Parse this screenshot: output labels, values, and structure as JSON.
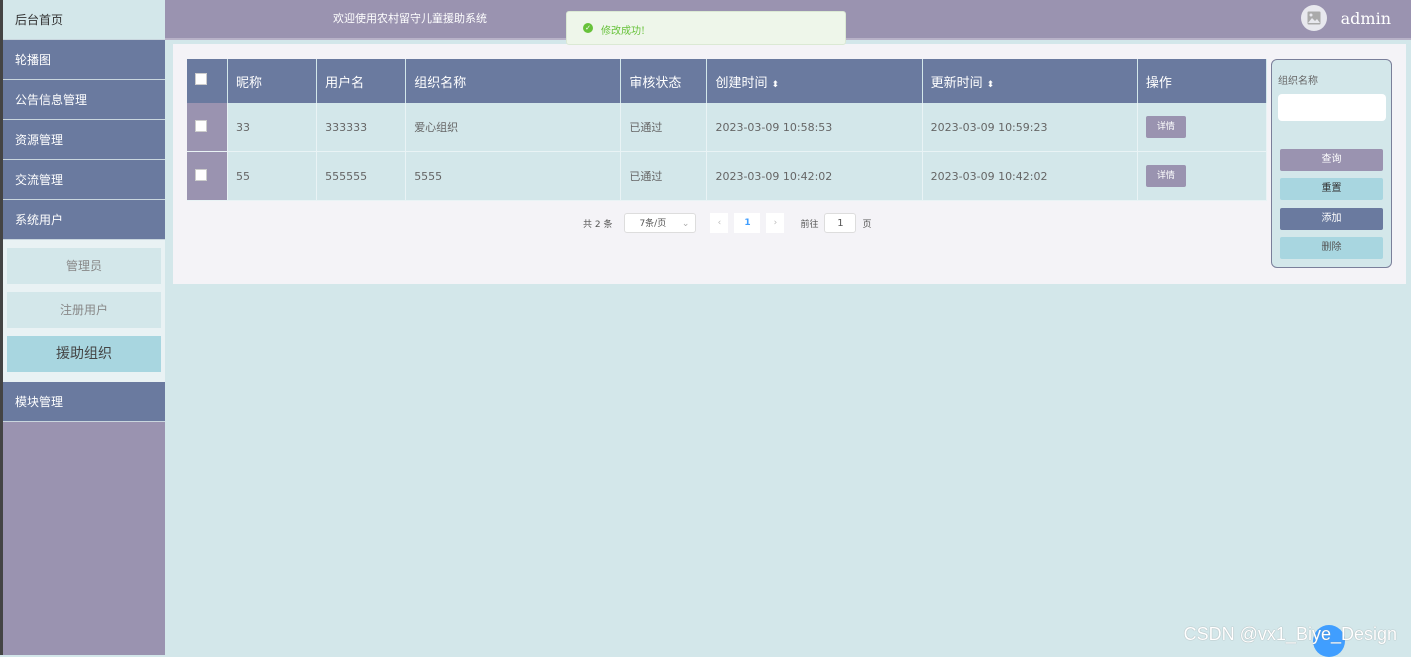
{
  "sidebar": {
    "items": [
      {
        "label": "后台首页"
      },
      {
        "label": "轮播图"
      },
      {
        "label": "公告信息管理"
      },
      {
        "label": "资源管理"
      },
      {
        "label": "交流管理"
      },
      {
        "label": "系统用户"
      }
    ],
    "sub_items": [
      {
        "label": "管理员"
      },
      {
        "label": "注册用户"
      },
      {
        "label": "援助组织"
      }
    ],
    "after": {
      "label": "模块管理"
    }
  },
  "header": {
    "welcome": "欢迎使用农村留守儿童援助系统",
    "username": "admin"
  },
  "toast": {
    "message": "修改成功!"
  },
  "table": {
    "columns": [
      "昵称",
      "用户名",
      "组织名称",
      "审核状态",
      "创建时间",
      "更新时间",
      "操作"
    ],
    "rows": [
      {
        "nickname": "33",
        "username": "333333",
        "org": "爱心组织",
        "status": "已通过",
        "created": "2023-03-09 10:58:53",
        "updated": "2023-03-09 10:59:23",
        "action": "详情"
      },
      {
        "nickname": "55",
        "username": "555555",
        "org": "5555",
        "status": "已通过",
        "created": "2023-03-09 10:42:02",
        "updated": "2023-03-09 10:42:02",
        "action": "详情"
      }
    ]
  },
  "pager": {
    "total": "共 2 条",
    "page_size": "7条/页",
    "current": "1",
    "goto_label": "前往",
    "goto_value": "1",
    "page_unit": "页"
  },
  "search": {
    "label": "组织名称",
    "buttons": {
      "query": "查询",
      "reset": "重置",
      "add": "添加",
      "delete": "删除"
    }
  },
  "watermark": "CSDN @vx1_Biye_Design",
  "colors": {
    "primary": "#6a7a9f",
    "secondary": "#9a93b0",
    "background": "#d3e7ea",
    "success": "#67c23a"
  }
}
